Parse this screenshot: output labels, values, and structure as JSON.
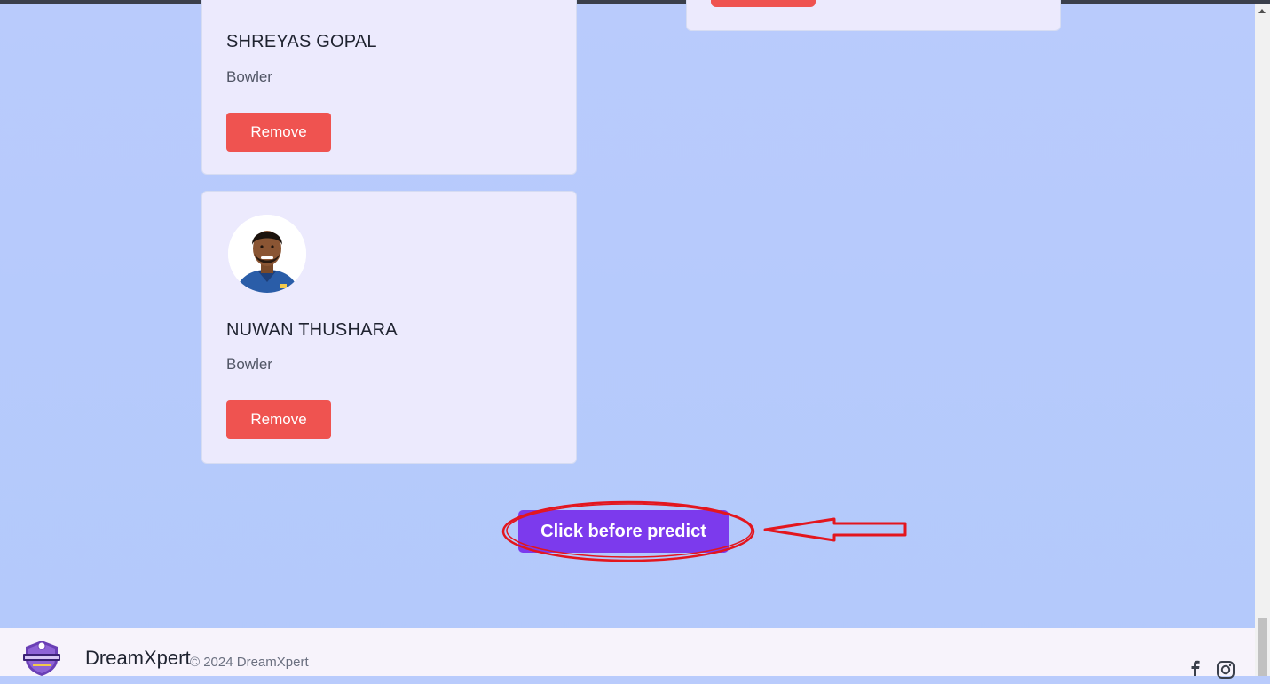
{
  "players": [
    {
      "name": "SHREYAS GOPAL",
      "role": "Bowler",
      "remove_label": "Remove"
    },
    {
      "name": "NUWAN THUSHARA",
      "role": "Bowler",
      "remove_label": "Remove"
    }
  ],
  "predict": {
    "label": "Click before predict"
  },
  "footer": {
    "brand": "DreamXpert",
    "copyright": "© 2024 DreamXpert"
  },
  "icons": {
    "facebook": "facebook-icon",
    "instagram": "instagram-icon",
    "logo": "dreamxpert-logo"
  },
  "colors": {
    "remove": "#ef5350",
    "predict": "#7c3aed",
    "annotation": "#e3161e",
    "background": "#b8cbfc"
  }
}
